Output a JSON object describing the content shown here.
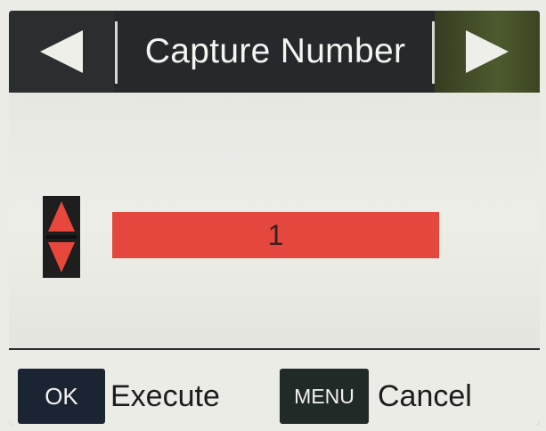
{
  "header": {
    "title": "Capture Number",
    "prev_icon": "triangle-left-icon",
    "next_icon": "triangle-right-icon"
  },
  "setting": {
    "value": "1",
    "spinner_icon": "up-down-arrows-icon"
  },
  "footer": {
    "ok_key": "OK",
    "ok_action": "Execute",
    "menu_key": "MENU",
    "menu_action": "Cancel"
  },
  "colors": {
    "value_bar": "#e4473d",
    "spinner_arrows": "#e8473c",
    "header_bg": "#25292b",
    "next_button_bg": "#4d5a2e"
  }
}
